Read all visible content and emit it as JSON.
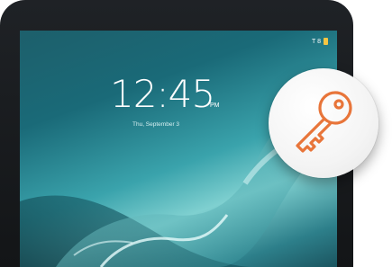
{
  "lockscreen": {
    "status_text": "T 8",
    "time": "12:45",
    "ampm": "PM",
    "date": "Thu, September 3"
  },
  "badge": {
    "icon": "key-icon",
    "color": "#e8753a"
  },
  "colors": {
    "bezel": "#17191c",
    "screen_top": "#1d5f6b",
    "screen_mid": "#3aa3ac",
    "battery": "#f5c542"
  }
}
